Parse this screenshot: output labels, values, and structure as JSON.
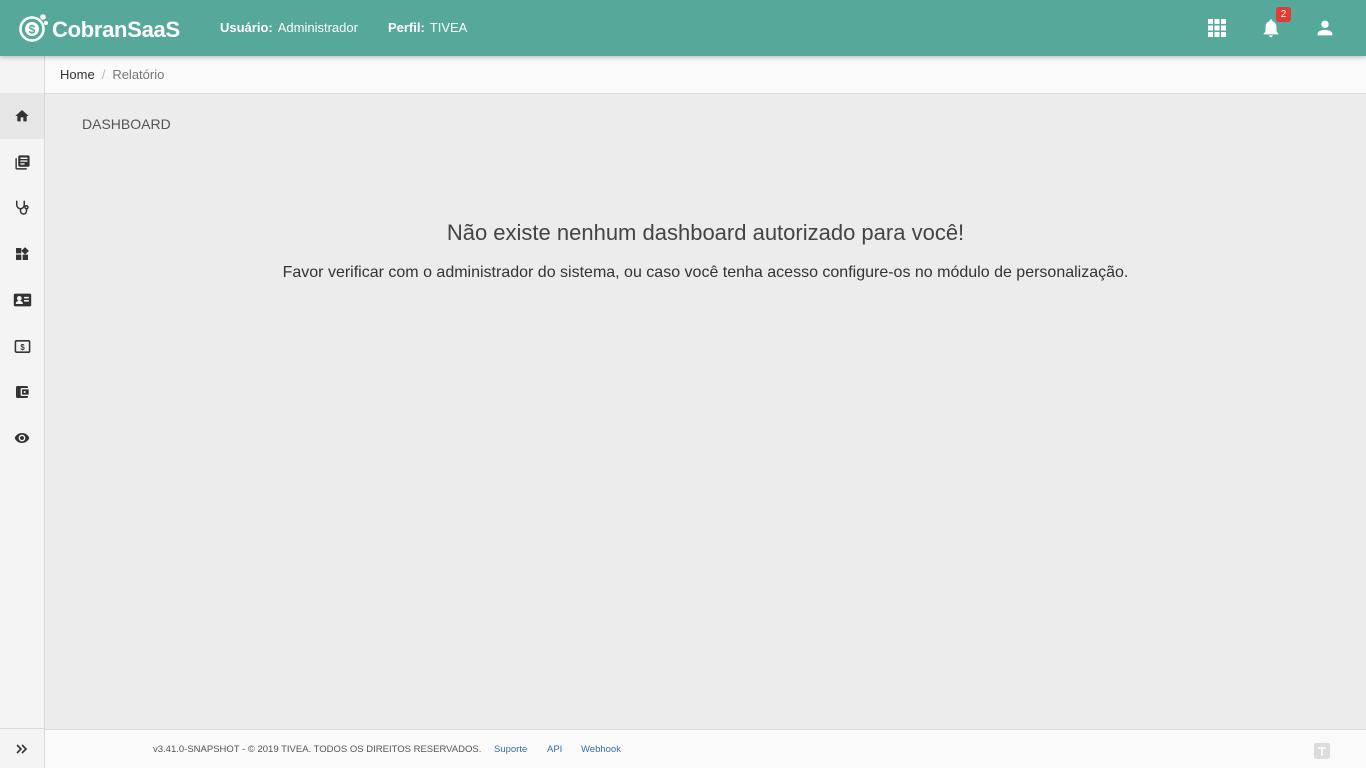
{
  "app": {
    "name": "CobranSaaS",
    "brand_color": "#55a89a"
  },
  "header": {
    "user_label": "Usuário:",
    "user_value": "Administrador",
    "profile_label": "Perfil:",
    "profile_value": "TIVEA",
    "icons": [
      "apps-grid-icon",
      "bell-icon",
      "user-icon"
    ],
    "notification_count": "2"
  },
  "sidebar": {
    "items": [
      {
        "icon": "home-icon",
        "active": true
      },
      {
        "icon": "library-books-icon"
      },
      {
        "icon": "stethoscope-icon"
      },
      {
        "icon": "widgets-icon"
      },
      {
        "icon": "contact-card-icon"
      },
      {
        "icon": "money-bill-icon"
      },
      {
        "icon": "wallet-icon"
      },
      {
        "icon": "eye-icon"
      }
    ],
    "toggle_icon": "double-chevron-right-icon"
  },
  "breadcrumb": {
    "home": "Home",
    "separator": "/",
    "current": "Relatório"
  },
  "main": {
    "title": "DASHBOARD",
    "empty_title": "Não existe nenhum dashboard autorizado para você!",
    "empty_message": "Favor verificar com o administrador do sistema, ou caso você tenha acesso configure-os no módulo de personalização."
  },
  "footer": {
    "copyright": "v3.41.0-SNAPSHOT - © 2019 TIVEA. TODOS OS DIREITOS RESERVADOS.",
    "links": [
      "Suporte",
      "API",
      "Webhook"
    ]
  }
}
